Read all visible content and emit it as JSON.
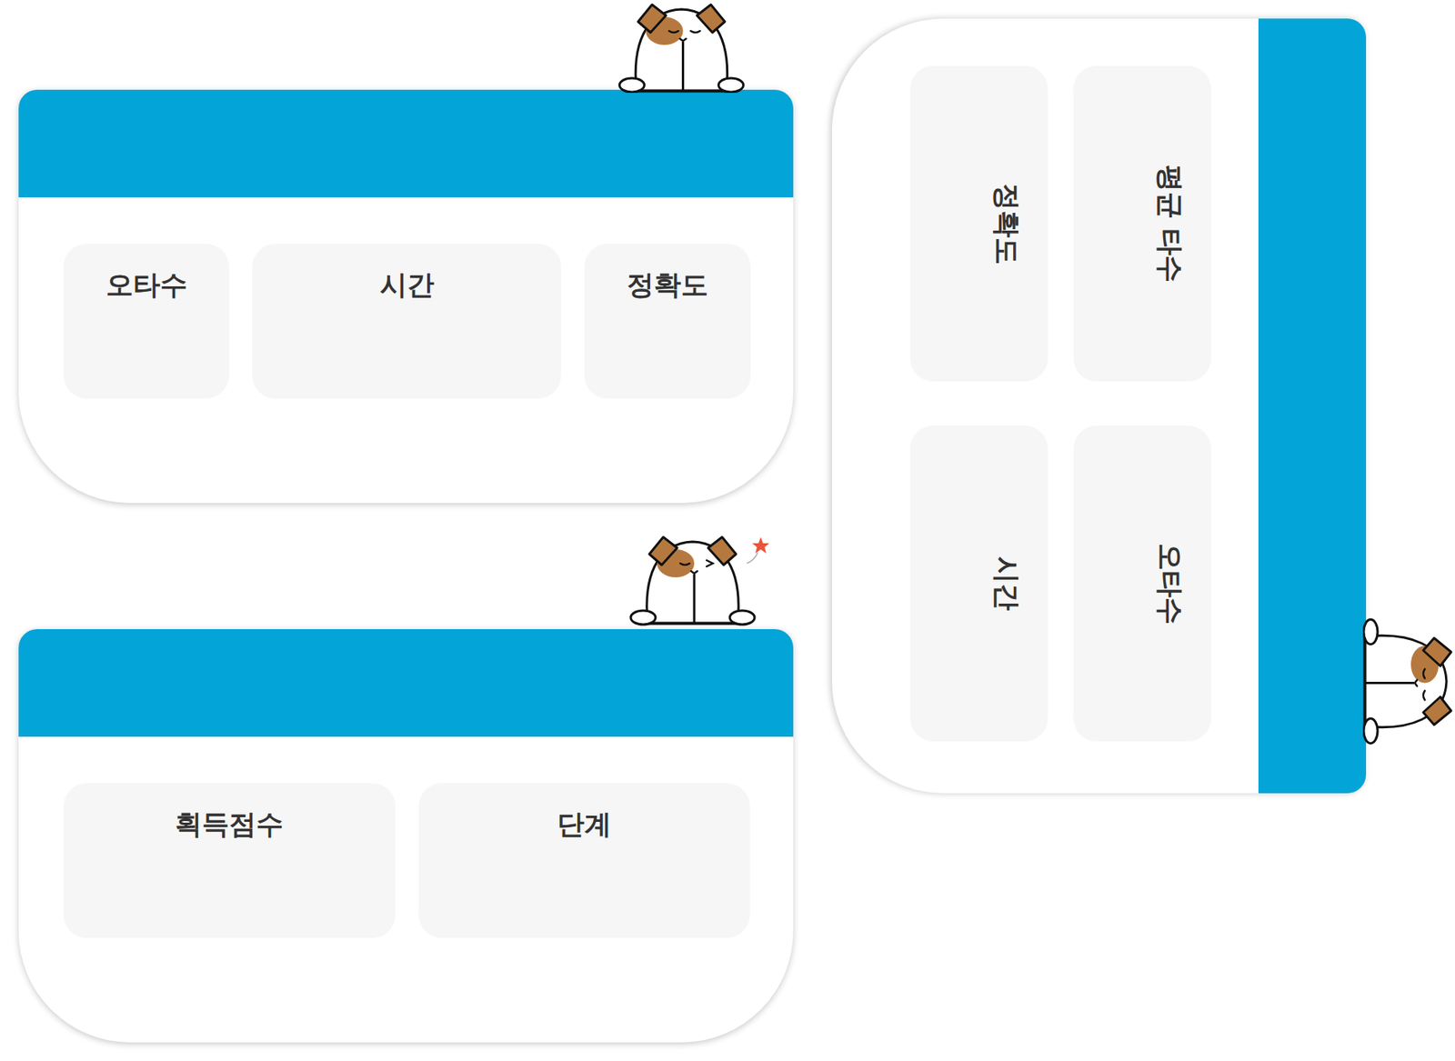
{
  "cards": [
    {
      "kind": "horizontal",
      "items": [
        {
          "label": "오타수"
        },
        {
          "label": "시간"
        },
        {
          "label": "정확도"
        }
      ]
    },
    {
      "kind": "horizontal",
      "items": [
        {
          "label": "획득점수"
        },
        {
          "label": "단계"
        }
      ]
    },
    {
      "kind": "rotated",
      "items": [
        {
          "label": "평균 타수"
        },
        {
          "label": "오타수"
        },
        {
          "label": "정확도"
        },
        {
          "label": "시간"
        }
      ]
    }
  ]
}
